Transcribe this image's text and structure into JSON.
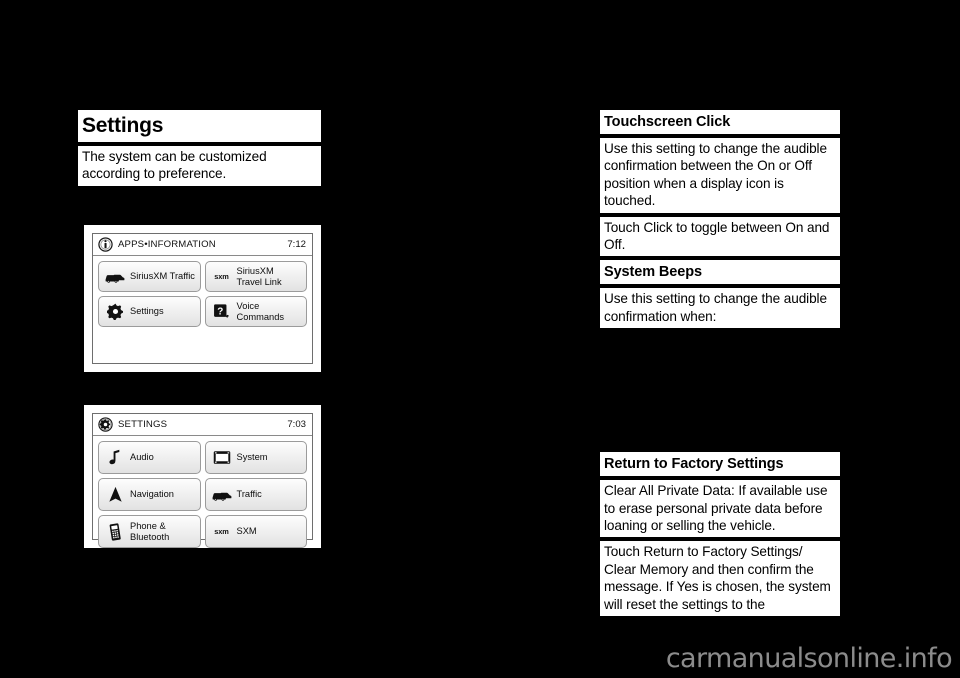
{
  "page": {
    "background_color": "#000000",
    "watermark": "carmanualsonline.info",
    "watermark_color": "#8c8c8c"
  },
  "left_column": {
    "blocks": [
      {
        "type": "heading",
        "text": "Settings"
      },
      {
        "type": "body",
        "text": "The system can be customized according to preference."
      }
    ]
  },
  "right_column": {
    "blocks": [
      {
        "type": "heading",
        "text": "Touchscreen Click"
      },
      {
        "type": "body",
        "text": "Use this setting to change the audible confirmation between the On or Off position when a display icon is touched."
      },
      {
        "type": "body",
        "text": "Touch Click to toggle between On and Off."
      },
      {
        "type": "heading",
        "text": "System Beeps"
      },
      {
        "type": "body",
        "text": "Use this setting to change the audible confirmation when:"
      },
      {
        "type": "heading",
        "text": "Return to Factory Settings"
      },
      {
        "type": "body",
        "text": "Clear All Private Data: If available use to erase personal private data before loaning or selling the vehicle."
      },
      {
        "type": "body",
        "text": "Touch Return to Factory Settings/ Clear Memory and then confirm the message. If Yes is chosen, the system will reset the settings to the"
      }
    ]
  },
  "figures": [
    {
      "id": "apps-information",
      "header": {
        "icon": "info-circle-icon",
        "title": "APPS•INFORMATION",
        "clock": "7:12"
      },
      "tiles": [
        {
          "icon": "traffic-cars-icon",
          "label": "SiriusXM Traffic"
        },
        {
          "icon": "sxm-text-icon",
          "icon_text": "sxm",
          "label": "SiriusXM\nTravel Link"
        },
        {
          "icon": "gear-icon",
          "label": "Settings"
        },
        {
          "icon": "voice-commands-icon",
          "label": "Voice\nCommands"
        }
      ]
    },
    {
      "id": "settings-menu",
      "header": {
        "icon": "gear-circle-icon",
        "title": "SETTINGS",
        "clock": "7:03"
      },
      "tiles": [
        {
          "icon": "music-note-icon",
          "label": "Audio"
        },
        {
          "icon": "display-screen-icon",
          "label": "System"
        },
        {
          "icon": "navigation-arrow-icon",
          "label": "Navigation"
        },
        {
          "icon": "traffic-cars-icon",
          "label": "Traffic"
        },
        {
          "icon": "mobile-phone-icon",
          "label": "Phone &\nBluetooth"
        },
        {
          "icon": "sxm-text-icon",
          "icon_text": "sxm",
          "label": "SXM"
        }
      ]
    }
  ]
}
